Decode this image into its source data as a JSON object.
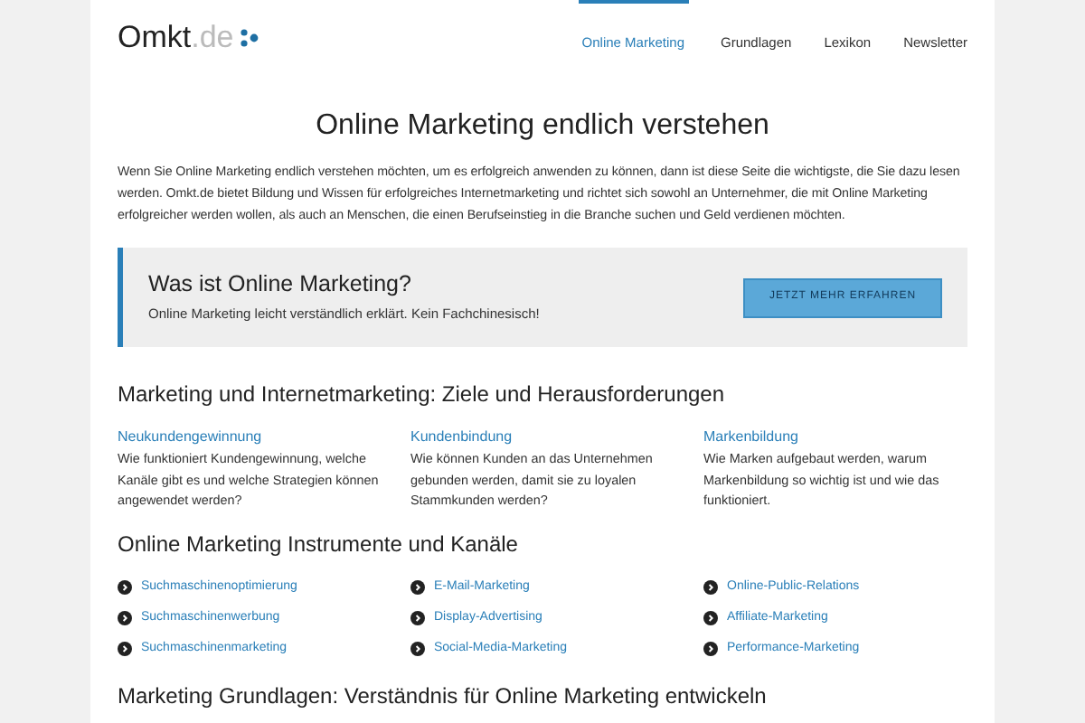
{
  "logo": {
    "name": "Omkt",
    "domain": ".de"
  },
  "nav": [
    {
      "label": "Online Marketing",
      "selected": true
    },
    {
      "label": "Grundlagen",
      "selected": false
    },
    {
      "label": "Lexikon",
      "selected": false
    },
    {
      "label": "Newsletter",
      "selected": false
    }
  ],
  "title": "Online Marketing endlich verstehen",
  "intro": "Wenn Sie Online Marketing endlich verstehen möchten, um es erfolgreich anwenden zu können, dann ist diese Seite die wichtigste, die Sie dazu lesen werden. Omkt.de bietet Bildung und Wissen für erfolgreiches Internetmarketing und richtet sich sowohl an Unternehmer, die mit Online Marketing erfolgreicher werden wollen, als auch an Menschen, die einen Berufseinstieg in die Branche suchen und Geld verdienen möchten.",
  "callout": {
    "title": "Was ist Online Marketing?",
    "text": "Online Marketing leicht verständlich erklärt. Kein Fachchinesisch!",
    "button": "JETZT MEHR ERFAHREN"
  },
  "goals": {
    "heading": "Marketing und Internetmarketing: Ziele und Herausforderungen",
    "items": [
      {
        "title": "Neukundengewinnung",
        "text": "Wie funktioniert Kundengewinnung, welche Kanäle gibt es und welche Strategien können angewendet werden?"
      },
      {
        "title": "Kundenbindung",
        "text": "Wie können Kunden an das Unternehmen gebunden werden, damit sie zu loyalen Stammkunden werden?"
      },
      {
        "title": "Markenbildung",
        "text": "Wie Marken aufgebaut werden, warum Markenbildung so wichtig ist und wie das funktioniert."
      }
    ]
  },
  "instruments": {
    "heading": "Online Marketing Instrumente und Kanäle",
    "links": [
      "Suchmaschinenoptimierung",
      "E-Mail-Marketing",
      "Online-Public-Relations",
      "Suchmaschinenwerbung",
      "Display-Advertising",
      "Affiliate-Marketing",
      "Suchmaschinenmarketing",
      "Social-Media-Marketing",
      "Performance-Marketing"
    ]
  },
  "basics": {
    "heading": "Marketing Grundlagen: Verständnis für Online Marketing entwickeln"
  }
}
